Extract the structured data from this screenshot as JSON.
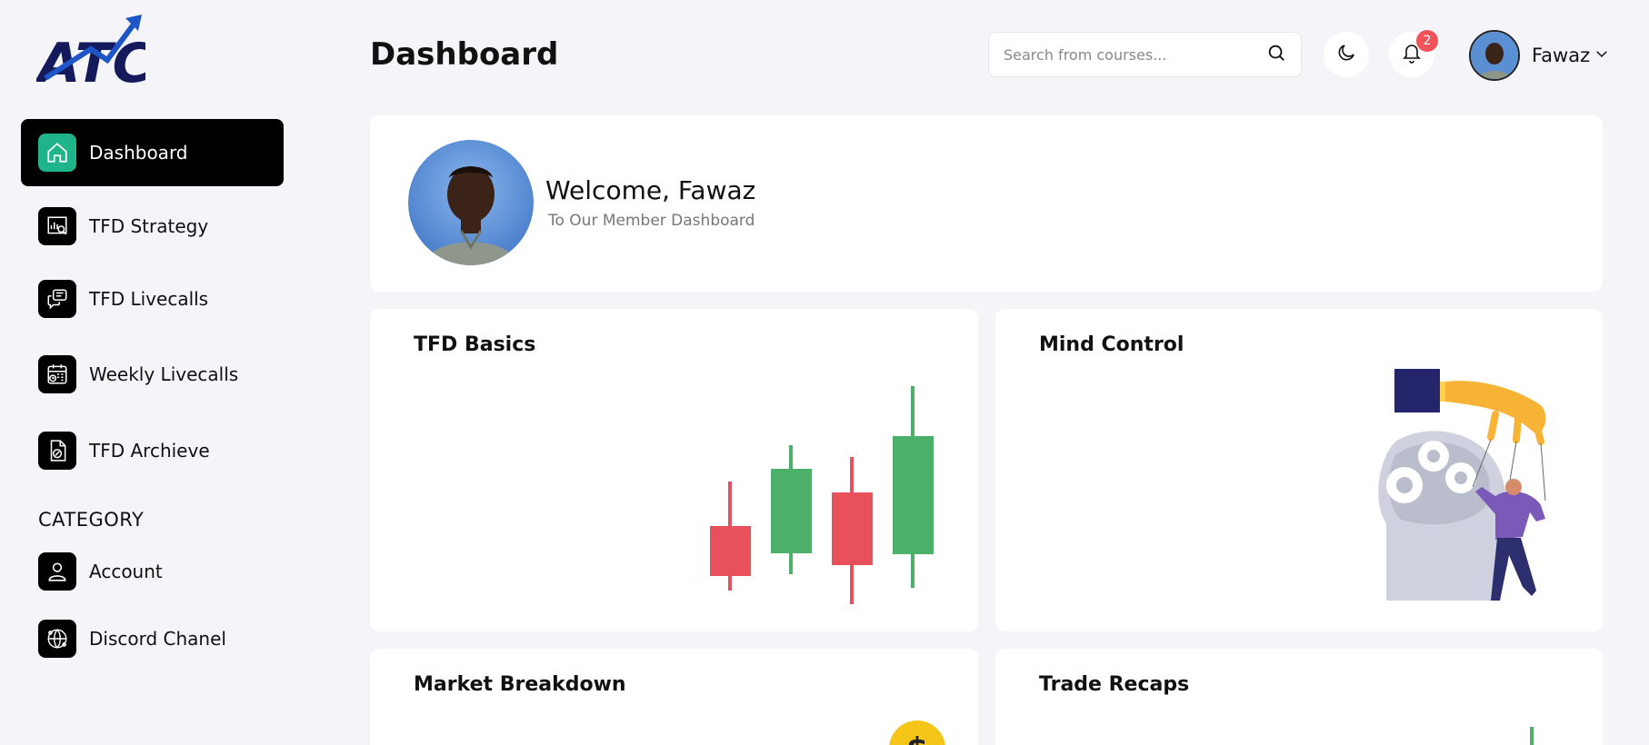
{
  "sidebar": {
    "logo_text": "ATC",
    "nav": [
      {
        "label": "Dashboard"
      },
      {
        "label": "TFD Strategy"
      },
      {
        "label": "TFD Livecalls"
      },
      {
        "label": "Weekly Livecalls"
      },
      {
        "label": "TFD Archieve"
      }
    ],
    "category_title": "CATEGORY",
    "category_items": [
      {
        "label": "Account"
      },
      {
        "label": "Discord Chanel"
      }
    ]
  },
  "header": {
    "title": "Dashboard",
    "search_placeholder": "Search from courses...",
    "notification_count": "2",
    "user_name": "Fawaz"
  },
  "welcome": {
    "greeting": "Welcome,  Fawaz",
    "subtitle": "To Our Member Dashboard"
  },
  "courses": [
    {
      "title": "TFD Basics"
    },
    {
      "title": "Mind Control"
    },
    {
      "title": "Market Breakdown"
    },
    {
      "title": "Trade Recaps"
    }
  ],
  "colors": {
    "accent": "#20b48a",
    "candle_up": "#4caf6a",
    "candle_down": "#e8505b",
    "badge": "#f0545a"
  }
}
